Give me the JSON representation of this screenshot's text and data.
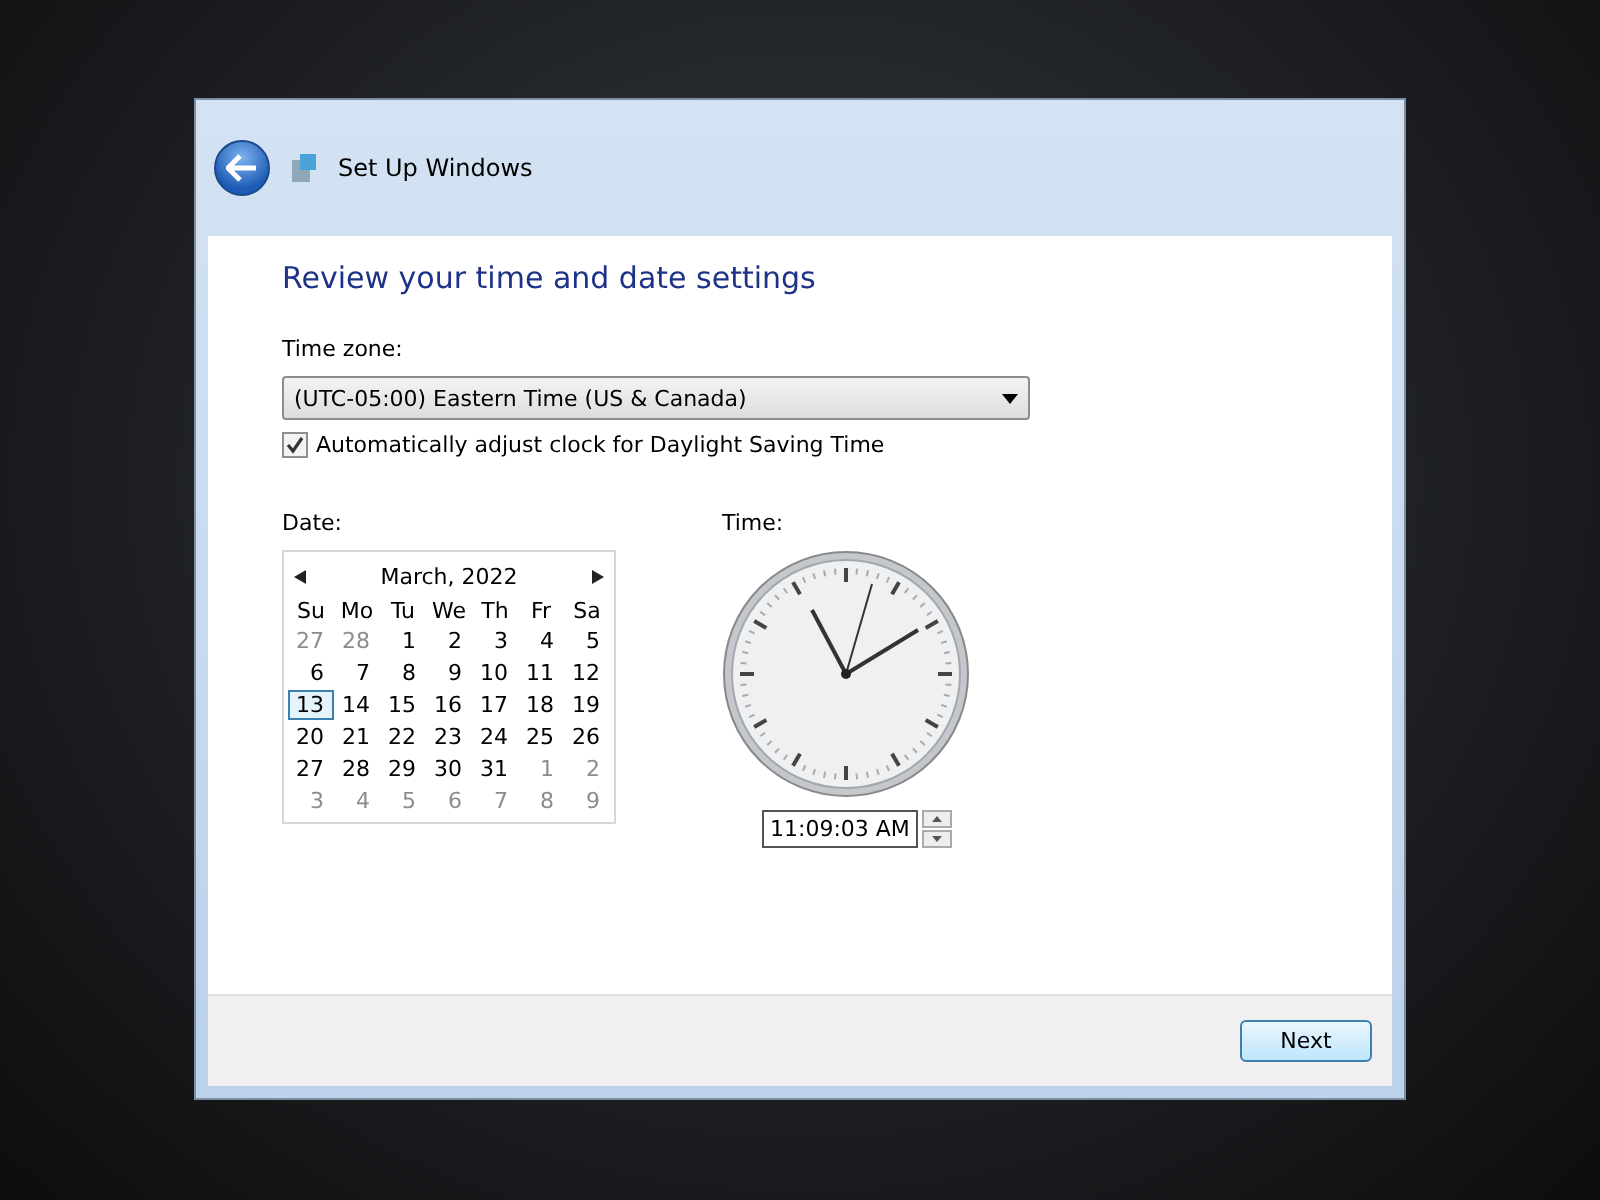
{
  "window": {
    "title": "Set Up Windows"
  },
  "heading": "Review your time and date settings",
  "time_zone": {
    "label": "Time zone:",
    "value": "(UTC-05:00) Eastern Time (US & Canada)"
  },
  "daylight_saving": {
    "label": "Automatically adjust clock for Daylight Saving Time",
    "checked": true
  },
  "date": {
    "label": "Date:",
    "month": "March, 2022",
    "weekdays": [
      "Su",
      "Mo",
      "Tu",
      "We",
      "Th",
      "Fr",
      "Sa"
    ],
    "weeks": [
      [
        {
          "day": "27",
          "outside": true,
          "selected": false
        },
        {
          "day": "28",
          "outside": true,
          "selected": false
        },
        {
          "day": "1",
          "outside": false,
          "selected": false
        },
        {
          "day": "2",
          "outside": false,
          "selected": false
        },
        {
          "day": "3",
          "outside": false,
          "selected": false
        },
        {
          "day": "4",
          "outside": false,
          "selected": false
        },
        {
          "day": "5",
          "outside": false,
          "selected": false
        }
      ],
      [
        {
          "day": "6",
          "outside": false,
          "selected": false
        },
        {
          "day": "7",
          "outside": false,
          "selected": false
        },
        {
          "day": "8",
          "outside": false,
          "selected": false
        },
        {
          "day": "9",
          "outside": false,
          "selected": false
        },
        {
          "day": "10",
          "outside": false,
          "selected": false
        },
        {
          "day": "11",
          "outside": false,
          "selected": false
        },
        {
          "day": "12",
          "outside": false,
          "selected": false
        }
      ],
      [
        {
          "day": "13",
          "outside": false,
          "selected": true
        },
        {
          "day": "14",
          "outside": false,
          "selected": false
        },
        {
          "day": "15",
          "outside": false,
          "selected": false
        },
        {
          "day": "16",
          "outside": false,
          "selected": false
        },
        {
          "day": "17",
          "outside": false,
          "selected": false
        },
        {
          "day": "18",
          "outside": false,
          "selected": false
        },
        {
          "day": "19",
          "outside": false,
          "selected": false
        }
      ],
      [
        {
          "day": "20",
          "outside": false,
          "selected": false
        },
        {
          "day": "21",
          "outside": false,
          "selected": false
        },
        {
          "day": "22",
          "outside": false,
          "selected": false
        },
        {
          "day": "23",
          "outside": false,
          "selected": false
        },
        {
          "day": "24",
          "outside": false,
          "selected": false
        },
        {
          "day": "25",
          "outside": false,
          "selected": false
        },
        {
          "day": "26",
          "outside": false,
          "selected": false
        }
      ],
      [
        {
          "day": "27",
          "outside": false,
          "selected": false
        },
        {
          "day": "28",
          "outside": false,
          "selected": false
        },
        {
          "day": "29",
          "outside": false,
          "selected": false
        },
        {
          "day": "30",
          "outside": false,
          "selected": false
        },
        {
          "day": "31",
          "outside": false,
          "selected": false
        },
        {
          "day": "1",
          "outside": true,
          "selected": false
        },
        {
          "day": "2",
          "outside": true,
          "selected": false
        }
      ],
      [
        {
          "day": "3",
          "outside": true,
          "selected": false
        },
        {
          "day": "4",
          "outside": true,
          "selected": false
        },
        {
          "day": "5",
          "outside": true,
          "selected": false
        },
        {
          "day": "6",
          "outside": true,
          "selected": false
        },
        {
          "day": "7",
          "outside": true,
          "selected": false
        },
        {
          "day": "8",
          "outside": true,
          "selected": false
        },
        {
          "day": "9",
          "outside": true,
          "selected": false
        }
      ]
    ]
  },
  "time": {
    "label": "Time:",
    "value": "11:09:03 AM"
  },
  "buttons": [
    "Next"
  ]
}
